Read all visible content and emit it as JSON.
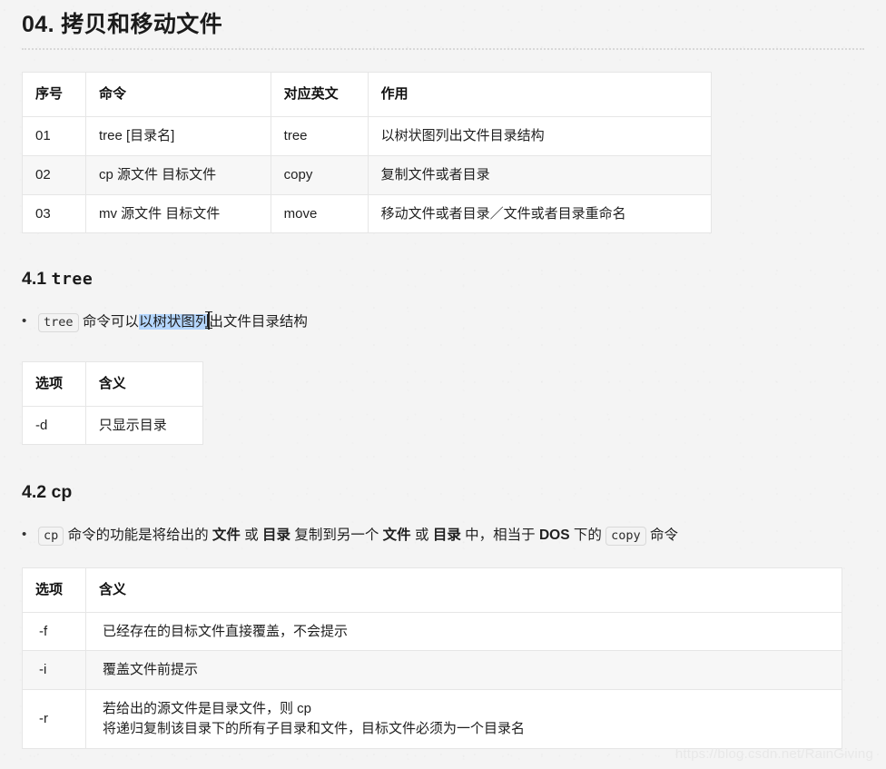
{
  "document": {
    "title": "04. 拷贝和移动文件",
    "watermark": "https://blog.csdn.net/RainGiving"
  },
  "command_table": {
    "headers": [
      "序号",
      "命令",
      "对应英文",
      "作用"
    ],
    "rows": [
      [
        "01",
        "tree [目录名]",
        "tree",
        "以树状图列出文件目录结构"
      ],
      [
        "02",
        "cp 源文件 目标文件",
        "copy",
        "复制文件或者目录"
      ],
      [
        "03",
        "mv 源文件 目标文件",
        "move",
        "移动文件或者目录／文件或者目录重命名"
      ]
    ]
  },
  "section_tree": {
    "heading_number": "4.1 ",
    "heading_code": "tree",
    "bullet": {
      "code": "tree",
      "text_before_selection": " 命令可以",
      "selected_text": "以树状图列",
      "text_after_selection": "出文件目录结构"
    },
    "options_table": {
      "headers": [
        "选项",
        "含义"
      ],
      "rows": [
        [
          "-d",
          "只显示目录"
        ]
      ]
    }
  },
  "section_cp": {
    "heading_number": "4.2 ",
    "heading_code": "cp",
    "bullet": {
      "code_cp": "cp",
      "part1": " 命令的功能是将给出的 ",
      "bold1": "文件",
      "part2": " 或 ",
      "bold2": "目录",
      "part3": " 复制到另一个 ",
      "bold3": "文件",
      "part4": " 或 ",
      "bold4": "目录",
      "part5": " 中，相当于 ",
      "bold5": "DOS",
      "part6": " 下的 ",
      "code_copy": "copy",
      "part7": " 命令"
    },
    "options_table": {
      "headers": [
        "选项",
        "含义"
      ],
      "rows": [
        [
          "-f",
          "已经存在的目标文件直接覆盖，不会提示"
        ],
        [
          "-i",
          "覆盖文件前提示"
        ],
        [
          "-r",
          "若给出的源文件是目录文件，则 cp\n将递归复制该目录下的所有子目录和文件，目标文件必须为一个目录名"
        ]
      ]
    }
  },
  "colors": {
    "page_background": "#f4f4f4",
    "table_background": "#ffffff",
    "table_alt_row": "#f7f7f7",
    "table_border": "#e6e6e6",
    "text": "#1f1f1f",
    "selection_highlight": "#b4d6fd",
    "watermark": "#e8e8e8"
  }
}
